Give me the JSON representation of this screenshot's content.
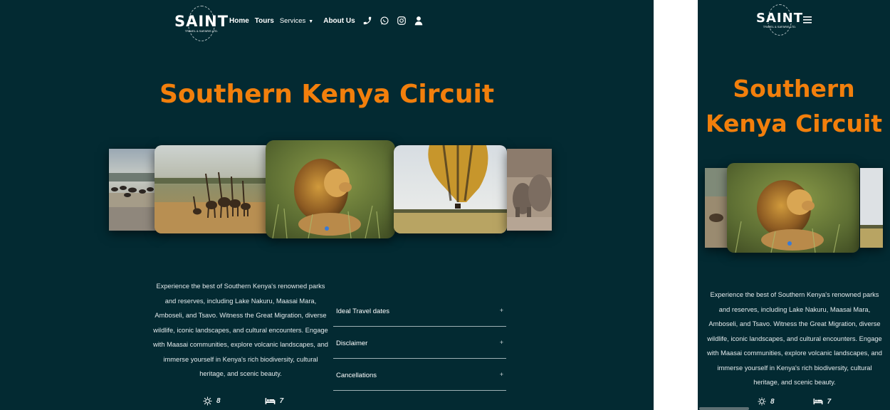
{
  "brand": {
    "name": "SAINT",
    "tagline": "TRAVEL & SAFARIS LTD."
  },
  "nav": {
    "home": "Home",
    "tours": "Tours",
    "services": "Services",
    "about": "About Us",
    "icons": [
      "phone-icon",
      "whatsapp-icon",
      "instagram-icon",
      "user-icon"
    ]
  },
  "page": {
    "title": "Southern Kenya Circuit",
    "intro": "Experience the best of Southern Kenya's renowned parks and reserves, including Lake Nakuru, Maasai Mara, Amboseli, and Tsavo. Witness the Great Migration, diverse wildlife, iconic landscapes, and cultural encounters. Engage with Maasai communities, explore volcanic landscapes, and immerse yourself in Kenya's rich biodiversity, cultural heritage, and scenic beauty.",
    "gallery": [
      "wildebeest-migration-photo",
      "giraffes-photo",
      "lion-photo",
      "hot-air-balloon-photo",
      "elephants-photo"
    ]
  },
  "accordion": [
    {
      "label": "Ideal Travel dates",
      "toggle": "+"
    },
    {
      "label": "Disclaimer",
      "toggle": "+"
    },
    {
      "label": "Cancellations",
      "toggle": "+"
    }
  ],
  "stats": {
    "days": "8",
    "nights": "7"
  },
  "colors": {
    "background": "#032a32",
    "accent": "#f27f0c",
    "text": "#ffffff"
  }
}
